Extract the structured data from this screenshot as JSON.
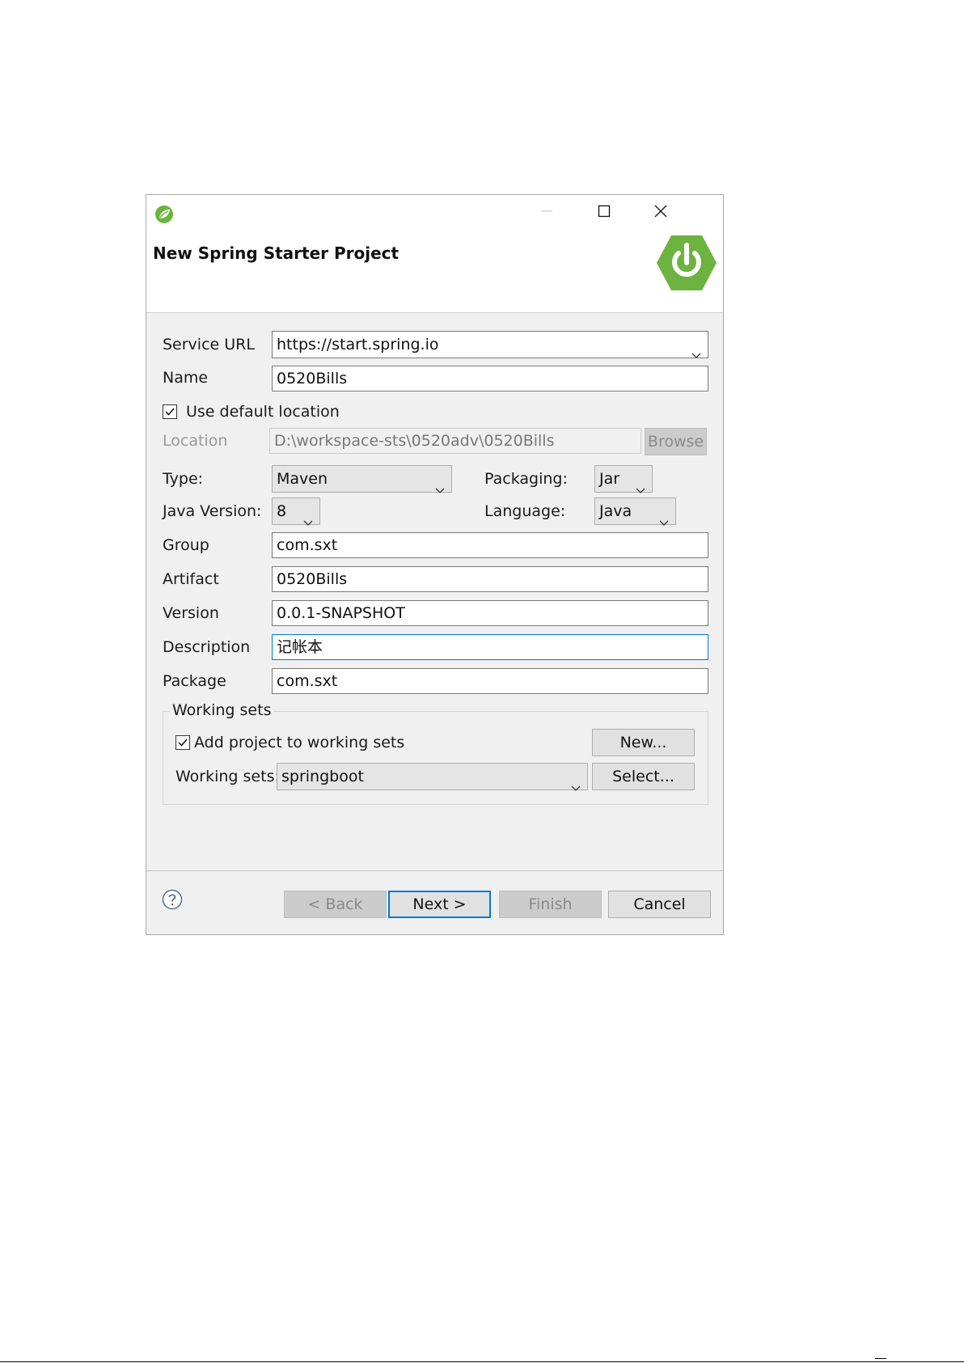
{
  "window": {
    "title": "New Spring Starter Project"
  },
  "form": {
    "service_url_label": "Service URL",
    "service_url_value": "https://start.spring.io",
    "name_label": "Name",
    "name_value": "0520Bills",
    "use_default_location_label": "Use default location",
    "use_default_location_checked": true,
    "location_label": "Location",
    "location_value": "D:\\workspace-sts\\0520adv\\0520Bills",
    "browse_label": "Browse",
    "type_label": "Type:",
    "type_value": "Maven",
    "packaging_label": "Packaging:",
    "packaging_value": "Jar",
    "java_version_label": "Java Version:",
    "java_version_value": "8",
    "language_label": "Language:",
    "language_value": "Java",
    "group_label": "Group",
    "group_value": "com.sxt",
    "artifact_label": "Artifact",
    "artifact_value": "0520Bills",
    "version_label": "Version",
    "version_value": "0.0.1-SNAPSHOT",
    "description_label": "Description",
    "description_value": "记帐本",
    "package_label": "Package",
    "package_value": "com.sxt"
  },
  "working_sets": {
    "group_title": "Working sets",
    "add_label": "Add project to working sets",
    "add_checked": true,
    "new_button": "New...",
    "sets_label": "Working sets:",
    "sets_value": "springboot",
    "select_button": "Select..."
  },
  "footer": {
    "back": "< Back",
    "next": "Next >",
    "finish": "Finish",
    "cancel": "Cancel"
  },
  "colors": {
    "spring_green": "#6db33f",
    "focus_blue": "#0078d7"
  },
  "icons": [
    "spring-leaf-icon",
    "minimize-icon",
    "maximize-icon",
    "close-icon",
    "spring-power-logo",
    "help-icon",
    "chevron-down-icon",
    "checkmark-icon"
  ]
}
